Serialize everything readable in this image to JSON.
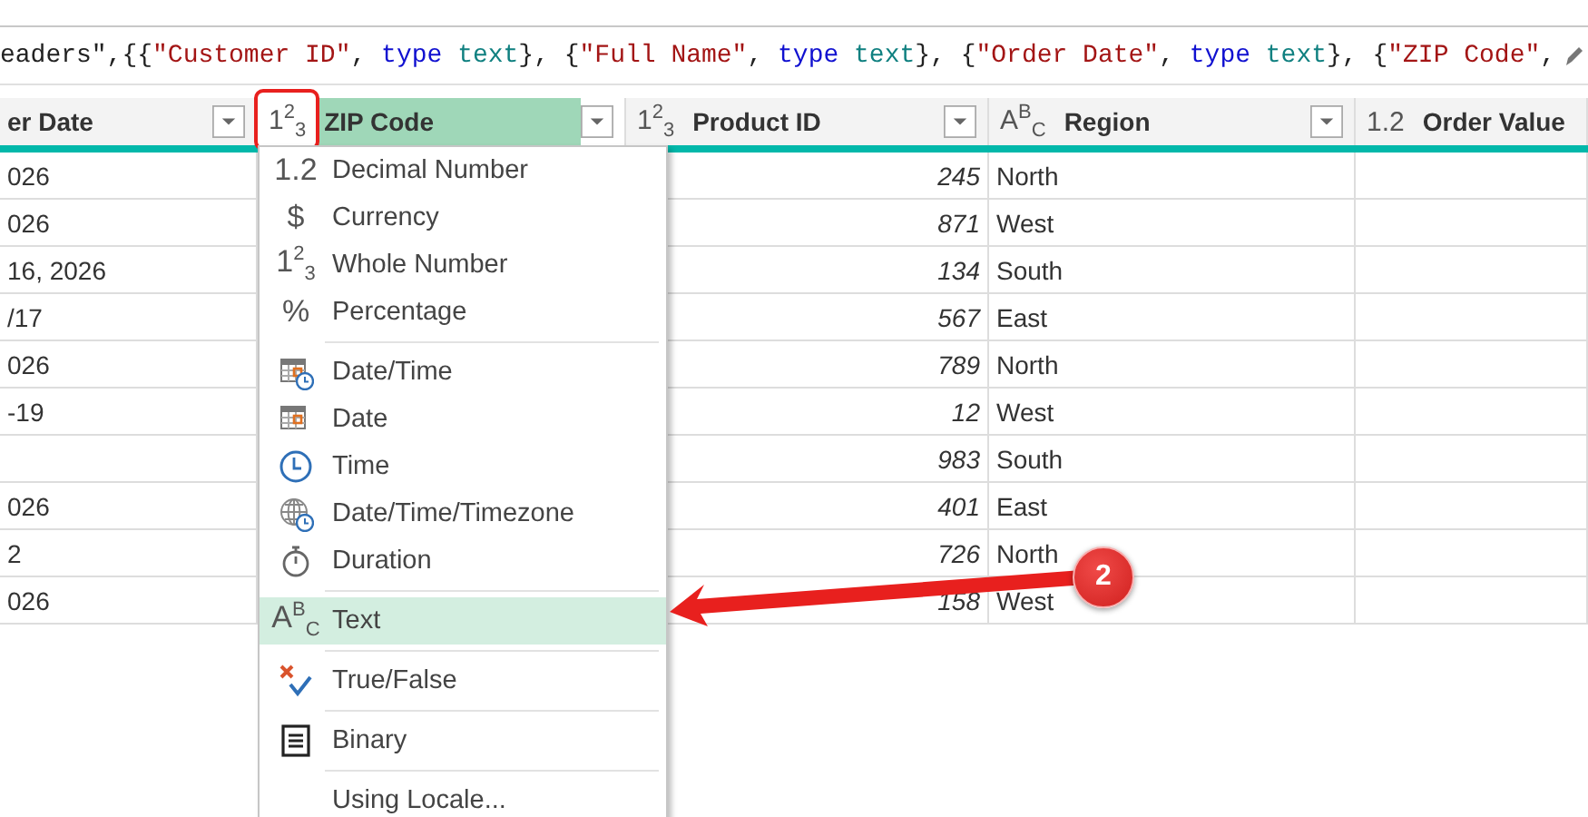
{
  "formula": [
    {
      "kind": "punct",
      "text": "eaders\",{{"
    },
    {
      "kind": "string",
      "text": "\"Customer ID\""
    },
    {
      "kind": "punct",
      "text": ", "
    },
    {
      "kind": "keyword",
      "text": "type "
    },
    {
      "kind": "type",
      "text": "text"
    },
    {
      "kind": "punct",
      "text": "}, {"
    },
    {
      "kind": "string",
      "text": "\"Full Name\""
    },
    {
      "kind": "punct",
      "text": ", "
    },
    {
      "kind": "keyword",
      "text": "type "
    },
    {
      "kind": "type",
      "text": "text"
    },
    {
      "kind": "punct",
      "text": "}, {"
    },
    {
      "kind": "string",
      "text": "\"Order Date\""
    },
    {
      "kind": "punct",
      "text": ", "
    },
    {
      "kind": "keyword",
      "text": "type "
    },
    {
      "kind": "type",
      "text": "text"
    },
    {
      "kind": "punct",
      "text": "}, {"
    },
    {
      "kind": "string",
      "text": "\"ZIP Code\""
    },
    {
      "kind": "punct",
      "text": ","
    }
  ],
  "table": {
    "columns": [
      {
        "label": "er Date",
        "filter": true,
        "selected": false
      },
      {
        "glyph": "1$^{2}$$_{3}$",
        "label": "ZIP Code",
        "filter": true,
        "selected": true
      },
      {
        "glyph": "1$^{2}$$_{3}$",
        "label": "Product ID",
        "filter": true,
        "selected": false
      },
      {
        "glyph": "A$^{B}$$_{C}$",
        "label": "Region",
        "filter": true,
        "selected": false
      },
      {
        "glyph": "1.2",
        "label": "Order Value",
        "filter": false,
        "selected": false
      }
    ],
    "rows": [
      {
        "order_date": "026",
        "product_id": "245",
        "region": "North"
      },
      {
        "order_date": "026",
        "product_id": "871",
        "region": "West"
      },
      {
        "order_date": "16, 2026",
        "product_id": "134",
        "region": "South"
      },
      {
        "order_date": "/17",
        "product_id": "567",
        "region": "East"
      },
      {
        "order_date": "026",
        "product_id": "789",
        "region": "North"
      },
      {
        "order_date": "-19",
        "product_id": "12",
        "region": "West"
      },
      {
        "product_id": "983",
        "region": "South"
      },
      {
        "order_date": "026",
        "product_id": "401",
        "region": "East"
      },
      {
        "order_date": "2",
        "product_id": "726",
        "region": "North"
      },
      {
        "order_date": "026",
        "product_id": "158",
        "region": "West"
      }
    ]
  },
  "type_menu": {
    "sections": [
      [
        {
          "glyph": "1.2",
          "label": "Decimal Number",
          "selected": false
        },
        {
          "glyph": "$",
          "label": "Currency",
          "selected": false
        },
        {
          "glyph": "1$^{2}$$_{3}$",
          "label": "Whole Number",
          "selected": false
        },
        {
          "glyph": "%",
          "label": "Percentage",
          "selected": false
        }
      ],
      [
        {
          "kind": "datetime",
          "label": "Date/Time",
          "selected": false
        },
        {
          "kind": "date",
          "label": "Date",
          "selected": false
        },
        {
          "kind": "time",
          "label": "Time",
          "selected": false
        },
        {
          "kind": "timezone",
          "label": "Date/Time/Timezone",
          "selected": false
        },
        {
          "kind": "duration",
          "label": "Duration",
          "selected": false
        }
      ],
      [
        {
          "glyph": "A$^{B}$$_{C}$",
          "label": "Text",
          "selected": true
        }
      ],
      [
        {
          "kind": "truefalse",
          "label": "True/False",
          "selected": false
        }
      ],
      [
        {
          "kind": "binary",
          "label": "Binary",
          "selected": false
        }
      ],
      [
        {
          "label": "Using Locale...",
          "selected": false
        }
      ]
    ]
  },
  "callout": {
    "label": "2"
  }
}
